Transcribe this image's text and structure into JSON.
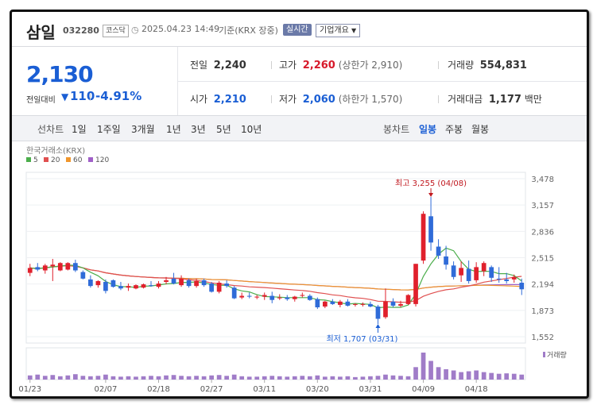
{
  "header": {
    "name": "삼일",
    "code": "032280",
    "market": "코스닥",
    "datetime": "2025.04.23 14:49",
    "basis": "기준(KRX 장중)",
    "realtime": "실시간",
    "company_overview": "기업개요"
  },
  "quote": {
    "price": "2,130",
    "change_label": "전일대비",
    "change": "110",
    "change_pct": "-4.91%",
    "prev_close": {
      "label": "전일",
      "value": "2,240"
    },
    "high": {
      "label": "고가",
      "value": "2,260",
      "note": "(상한가 2,910)"
    },
    "volume": {
      "label": "거래량",
      "value": "554,831"
    },
    "open": {
      "label": "시가",
      "value": "2,210"
    },
    "low": {
      "label": "저가",
      "value": "2,060",
      "note": "(하한가 1,570)"
    },
    "turnover": {
      "label": "거래대금",
      "value": "1,177",
      "unit": "백만"
    }
  },
  "tabs": {
    "line_label": "선차트",
    "line_periods": [
      "1일",
      "1주일",
      "3개월",
      "1년",
      "3년",
      "5년",
      "10년"
    ],
    "candle_label": "봉차트",
    "candle_periods": [
      "일봉",
      "주봉",
      "월봉"
    ],
    "candle_selected": "일봉"
  },
  "colors": {
    "up": "#e0202c",
    "down": "#2f6bd8",
    "accent": "#1a5ed4"
  },
  "chart_data": {
    "type": "candlestick",
    "source_label": "한국거래소(KRX)",
    "legend": [
      {
        "name": "5",
        "color": "#4cae4c"
      },
      {
        "name": "20",
        "color": "#e05050"
      },
      {
        "name": "60",
        "color": "#f0962d"
      },
      {
        "name": "120",
        "color": "#a060c8"
      }
    ],
    "y_ticks": [
      3478,
      3157,
      2836,
      2515,
      2194,
      1873,
      1552
    ],
    "ylim": [
      1552,
      3478
    ],
    "x_ticks": [
      {
        "label": "01/23",
        "index": 0
      },
      {
        "label": "02/07",
        "index": 10
      },
      {
        "label": "02/18",
        "index": 17
      },
      {
        "label": "02/27",
        "index": 24
      },
      {
        "label": "03/11",
        "index": 31
      },
      {
        "label": "03/20",
        "index": 38
      },
      {
        "label": "03/31",
        "index": 45
      },
      {
        "label": "04/09",
        "index": 52
      },
      {
        "label": "04/18",
        "index": 59
      }
    ],
    "candles": [
      {
        "o": 2330,
        "h": 2440,
        "l": 2290,
        "c": 2390
      },
      {
        "o": 2400,
        "h": 2450,
        "l": 2350,
        "c": 2370
      },
      {
        "o": 2360,
        "h": 2440,
        "l": 2320,
        "c": 2420
      },
      {
        "o": 2410,
        "h": 2500,
        "l": 2230,
        "c": 2430
      },
      {
        "o": 2360,
        "h": 2460,
        "l": 2350,
        "c": 2450
      },
      {
        "o": 2370,
        "h": 2460,
        "l": 2360,
        "c": 2450
      },
      {
        "o": 2450,
        "h": 2490,
        "l": 2340,
        "c": 2360
      },
      {
        "o": 2340,
        "h": 2360,
        "l": 2250,
        "c": 2260
      },
      {
        "o": 2250,
        "h": 2300,
        "l": 2150,
        "c": 2170
      },
      {
        "o": 2180,
        "h": 2240,
        "l": 2150,
        "c": 2230
      },
      {
        "o": 2220,
        "h": 2250,
        "l": 2080,
        "c": 2110
      },
      {
        "o": 2240,
        "h": 2250,
        "l": 2150,
        "c": 2160
      },
      {
        "o": 2170,
        "h": 2220,
        "l": 2120,
        "c": 2140
      },
      {
        "o": 2150,
        "h": 2200,
        "l": 2110,
        "c": 2170
      },
      {
        "o": 2140,
        "h": 2190,
        "l": 2130,
        "c": 2180
      },
      {
        "o": 2150,
        "h": 2200,
        "l": 2140,
        "c": 2190
      },
      {
        "o": 2180,
        "h": 2230,
        "l": 2160,
        "c": 2170
      },
      {
        "o": 2160,
        "h": 2230,
        "l": 2140,
        "c": 2200
      },
      {
        "o": 2220,
        "h": 2280,
        "l": 2190,
        "c": 2240
      },
      {
        "o": 2260,
        "h": 2330,
        "l": 2190,
        "c": 2200
      },
      {
        "o": 2180,
        "h": 2300,
        "l": 2160,
        "c": 2260
      },
      {
        "o": 2240,
        "h": 2260,
        "l": 2150,
        "c": 2170
      },
      {
        "o": 2170,
        "h": 2260,
        "l": 2150,
        "c": 2230
      },
      {
        "o": 2240,
        "h": 2260,
        "l": 2160,
        "c": 2180
      },
      {
        "o": 2200,
        "h": 2220,
        "l": 2090,
        "c": 2100
      },
      {
        "o": 2100,
        "h": 2230,
        "l": 2080,
        "c": 2210
      },
      {
        "o": 2200,
        "h": 2240,
        "l": 2150,
        "c": 2170
      },
      {
        "o": 2150,
        "h": 2170,
        "l": 2010,
        "c": 2020
      },
      {
        "o": 2030,
        "h": 2090,
        "l": 2010,
        "c": 2050
      },
      {
        "o": 2050,
        "h": 2090,
        "l": 2020,
        "c": 2040
      },
      {
        "o": 2030,
        "h": 2060,
        "l": 2010,
        "c": 2040
      },
      {
        "o": 2040,
        "h": 2090,
        "l": 2000,
        "c": 2060
      },
      {
        "o": 2050,
        "h": 2100,
        "l": 1960,
        "c": 2000
      },
      {
        "o": 2020,
        "h": 2070,
        "l": 2000,
        "c": 2030
      },
      {
        "o": 2030,
        "h": 2060,
        "l": 1990,
        "c": 2010
      },
      {
        "o": 2010,
        "h": 2050,
        "l": 1980,
        "c": 2040
      },
      {
        "o": 2050,
        "h": 2090,
        "l": 2030,
        "c": 2060
      },
      {
        "o": 2050,
        "h": 2070,
        "l": 1990,
        "c": 2000
      },
      {
        "o": 2010,
        "h": 2030,
        "l": 1890,
        "c": 1910
      },
      {
        "o": 1920,
        "h": 1990,
        "l": 1900,
        "c": 1980
      },
      {
        "o": 1980,
        "h": 2010,
        "l": 1940,
        "c": 1950
      },
      {
        "o": 1940,
        "h": 2000,
        "l": 1910,
        "c": 1980
      },
      {
        "o": 1980,
        "h": 2010,
        "l": 1920,
        "c": 1930
      },
      {
        "o": 1940,
        "h": 1960,
        "l": 1920,
        "c": 1950
      },
      {
        "o": 1940,
        "h": 1970,
        "l": 1920,
        "c": 1950
      },
      {
        "o": 1950,
        "h": 1980,
        "l": 1910,
        "c": 1920
      },
      {
        "o": 1920,
        "h": 1940,
        "l": 1707,
        "c": 1770
      },
      {
        "o": 1790,
        "h": 2140,
        "l": 1770,
        "c": 1980
      },
      {
        "o": 1980,
        "h": 2020,
        "l": 1910,
        "c": 1930
      },
      {
        "o": 1930,
        "h": 1990,
        "l": 1910,
        "c": 1950
      },
      {
        "o": 1950,
        "h": 2070,
        "l": 1940,
        "c": 2060
      },
      {
        "o": 1950,
        "h": 2440,
        "l": 1920,
        "c": 2440
      },
      {
        "o": 2480,
        "h": 3080,
        "l": 2440,
        "c": 3050
      },
      {
        "o": 3020,
        "h": 3255,
        "l": 2600,
        "c": 2700
      },
      {
        "o": 2650,
        "h": 2740,
        "l": 2500,
        "c": 2540
      },
      {
        "o": 2530,
        "h": 2660,
        "l": 2370,
        "c": 2430
      },
      {
        "o": 2420,
        "h": 2470,
        "l": 2250,
        "c": 2280
      },
      {
        "o": 2300,
        "h": 2470,
        "l": 2220,
        "c": 2390
      },
      {
        "o": 2380,
        "h": 2480,
        "l": 2200,
        "c": 2230
      },
      {
        "o": 2240,
        "h": 2460,
        "l": 2210,
        "c": 2400
      },
      {
        "o": 2350,
        "h": 2470,
        "l": 2290,
        "c": 2450
      },
      {
        "o": 2400,
        "h": 2420,
        "l": 2220,
        "c": 2270
      },
      {
        "o": 2260,
        "h": 2400,
        "l": 2210,
        "c": 2250
      },
      {
        "o": 2250,
        "h": 2330,
        "l": 2200,
        "c": 2230
      },
      {
        "o": 2250,
        "h": 2310,
        "l": 2210,
        "c": 2280
      },
      {
        "o": 2210,
        "h": 2260,
        "l": 2060,
        "c": 2130
      }
    ],
    "volumes": [
      10,
      12,
      9,
      11,
      8,
      10,
      13,
      9,
      8,
      9,
      12,
      8,
      7,
      8,
      7,
      8,
      9,
      8,
      10,
      11,
      9,
      8,
      9,
      8,
      10,
      11,
      9,
      12,
      8,
      7,
      7,
      8,
      9,
      8,
      7,
      8,
      9,
      8,
      10,
      7,
      8,
      7,
      8,
      6,
      7,
      8,
      9,
      12,
      10,
      9,
      8,
      30,
      65,
      45,
      30,
      25,
      22,
      18,
      20,
      22,
      18,
      16,
      14,
      15,
      14,
      12
    ],
    "ma5_label": "5",
    "annotation_high": {
      "text": "최고 3,255 (04/08)",
      "index": 53,
      "value": 3255
    },
    "annotation_low": {
      "text": "최저 1,707 (03/31)",
      "index": 46,
      "value": 1707
    },
    "volume_label": "거래량",
    "grid": true
  }
}
